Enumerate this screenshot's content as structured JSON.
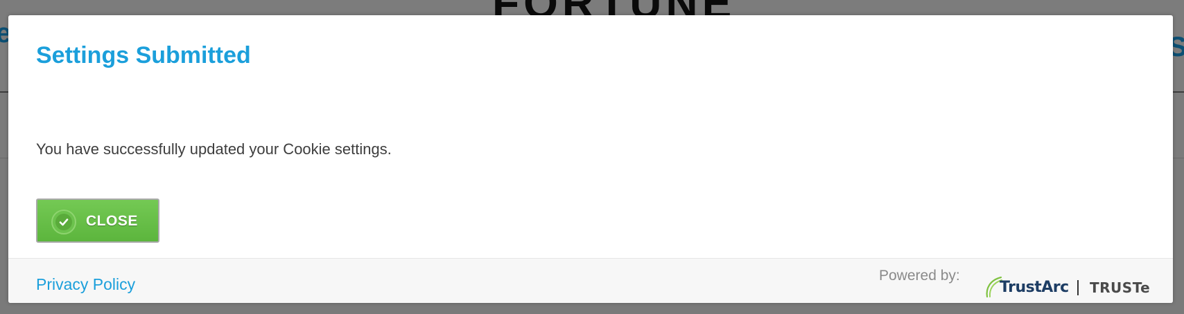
{
  "background": {
    "logo_text": "FORTUNE",
    "left_fragment": "e",
    "right_fragment": "S"
  },
  "modal": {
    "title": "Settings Submitted",
    "message": "You have successfully updated your Cookie settings.",
    "close_button": {
      "label": "CLOSE",
      "icon": "checkmark-icon",
      "color": "#6cc24d"
    },
    "footer": {
      "privacy_link": "Privacy Policy",
      "powered_by": "Powered by:",
      "brand_primary": "TrustArc",
      "brand_secondary": "TRUSTe"
    }
  },
  "colors": {
    "title": "#1b9fdb",
    "link": "#1b9fdb",
    "button_green": "#6cc24d",
    "brand_navy": "#1d3d64",
    "brand_arc_green": "#7fc241"
  }
}
